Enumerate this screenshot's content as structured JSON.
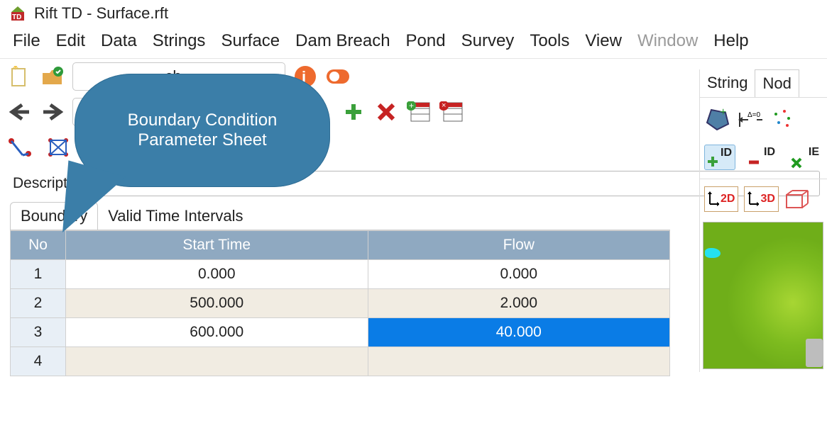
{
  "title": "Rift TD - Surface.rft",
  "menu": [
    "File",
    "Edit",
    "Data",
    "Strings",
    "Surface",
    "Dam Breach",
    "Pond",
    "Survey",
    "Tools",
    "View",
    "Window",
    "Help"
  ],
  "menu_disabled": [
    "Window"
  ],
  "callout": {
    "line1": "Boundary Condition",
    "line2": "Parameter Sheet"
  },
  "combo1_value": "ch",
  "combo2_value": "",
  "description_label": "Description",
  "description_value": "",
  "right_tabs": [
    "String",
    "Nod"
  ],
  "right_tabs_active": "Nod",
  "id_label": "ID",
  "axis_2d": "2D",
  "axis_3d": "3D",
  "main_tabs": [
    "Boundary",
    "Valid Time Intervals"
  ],
  "main_tabs_active": "Boundary",
  "table": {
    "columns": [
      "No",
      "Start Time",
      "Flow"
    ],
    "rows": [
      {
        "no": "1",
        "start": "0.000",
        "flow": "0.000"
      },
      {
        "no": "2",
        "start": "500.000",
        "flow": "2.000"
      },
      {
        "no": "3",
        "start": "600.000",
        "flow": "40.000"
      },
      {
        "no": "4",
        "start": "",
        "flow": ""
      }
    ],
    "selected": {
      "row": 3,
      "col": "flow"
    }
  }
}
